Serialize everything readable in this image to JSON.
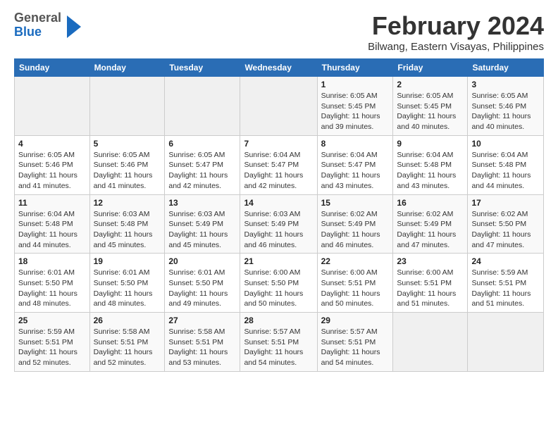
{
  "logo": {
    "line1": "General",
    "line2": "Blue"
  },
  "title": "February 2024",
  "subtitle": "Bilwang, Eastern Visayas, Philippines",
  "days_of_week": [
    "Sunday",
    "Monday",
    "Tuesday",
    "Wednesday",
    "Thursday",
    "Friday",
    "Saturday"
  ],
  "weeks": [
    [
      {
        "day": "",
        "info": ""
      },
      {
        "day": "",
        "info": ""
      },
      {
        "day": "",
        "info": ""
      },
      {
        "day": "",
        "info": ""
      },
      {
        "day": "1",
        "info": "Sunrise: 6:05 AM\nSunset: 5:45 PM\nDaylight: 11 hours and 39 minutes."
      },
      {
        "day": "2",
        "info": "Sunrise: 6:05 AM\nSunset: 5:45 PM\nDaylight: 11 hours and 40 minutes."
      },
      {
        "day": "3",
        "info": "Sunrise: 6:05 AM\nSunset: 5:46 PM\nDaylight: 11 hours and 40 minutes."
      }
    ],
    [
      {
        "day": "4",
        "info": "Sunrise: 6:05 AM\nSunset: 5:46 PM\nDaylight: 11 hours and 41 minutes."
      },
      {
        "day": "5",
        "info": "Sunrise: 6:05 AM\nSunset: 5:46 PM\nDaylight: 11 hours and 41 minutes."
      },
      {
        "day": "6",
        "info": "Sunrise: 6:05 AM\nSunset: 5:47 PM\nDaylight: 11 hours and 42 minutes."
      },
      {
        "day": "7",
        "info": "Sunrise: 6:04 AM\nSunset: 5:47 PM\nDaylight: 11 hours and 42 minutes."
      },
      {
        "day": "8",
        "info": "Sunrise: 6:04 AM\nSunset: 5:47 PM\nDaylight: 11 hours and 43 minutes."
      },
      {
        "day": "9",
        "info": "Sunrise: 6:04 AM\nSunset: 5:48 PM\nDaylight: 11 hours and 43 minutes."
      },
      {
        "day": "10",
        "info": "Sunrise: 6:04 AM\nSunset: 5:48 PM\nDaylight: 11 hours and 44 minutes."
      }
    ],
    [
      {
        "day": "11",
        "info": "Sunrise: 6:04 AM\nSunset: 5:48 PM\nDaylight: 11 hours and 44 minutes."
      },
      {
        "day": "12",
        "info": "Sunrise: 6:03 AM\nSunset: 5:48 PM\nDaylight: 11 hours and 45 minutes."
      },
      {
        "day": "13",
        "info": "Sunrise: 6:03 AM\nSunset: 5:49 PM\nDaylight: 11 hours and 45 minutes."
      },
      {
        "day": "14",
        "info": "Sunrise: 6:03 AM\nSunset: 5:49 PM\nDaylight: 11 hours and 46 minutes."
      },
      {
        "day": "15",
        "info": "Sunrise: 6:02 AM\nSunset: 5:49 PM\nDaylight: 11 hours and 46 minutes."
      },
      {
        "day": "16",
        "info": "Sunrise: 6:02 AM\nSunset: 5:49 PM\nDaylight: 11 hours and 47 minutes."
      },
      {
        "day": "17",
        "info": "Sunrise: 6:02 AM\nSunset: 5:50 PM\nDaylight: 11 hours and 47 minutes."
      }
    ],
    [
      {
        "day": "18",
        "info": "Sunrise: 6:01 AM\nSunset: 5:50 PM\nDaylight: 11 hours and 48 minutes."
      },
      {
        "day": "19",
        "info": "Sunrise: 6:01 AM\nSunset: 5:50 PM\nDaylight: 11 hours and 48 minutes."
      },
      {
        "day": "20",
        "info": "Sunrise: 6:01 AM\nSunset: 5:50 PM\nDaylight: 11 hours and 49 minutes."
      },
      {
        "day": "21",
        "info": "Sunrise: 6:00 AM\nSunset: 5:50 PM\nDaylight: 11 hours and 50 minutes."
      },
      {
        "day": "22",
        "info": "Sunrise: 6:00 AM\nSunset: 5:51 PM\nDaylight: 11 hours and 50 minutes."
      },
      {
        "day": "23",
        "info": "Sunrise: 6:00 AM\nSunset: 5:51 PM\nDaylight: 11 hours and 51 minutes."
      },
      {
        "day": "24",
        "info": "Sunrise: 5:59 AM\nSunset: 5:51 PM\nDaylight: 11 hours and 51 minutes."
      }
    ],
    [
      {
        "day": "25",
        "info": "Sunrise: 5:59 AM\nSunset: 5:51 PM\nDaylight: 11 hours and 52 minutes."
      },
      {
        "day": "26",
        "info": "Sunrise: 5:58 AM\nSunset: 5:51 PM\nDaylight: 11 hours and 52 minutes."
      },
      {
        "day": "27",
        "info": "Sunrise: 5:58 AM\nSunset: 5:51 PM\nDaylight: 11 hours and 53 minutes."
      },
      {
        "day": "28",
        "info": "Sunrise: 5:57 AM\nSunset: 5:51 PM\nDaylight: 11 hours and 54 minutes."
      },
      {
        "day": "29",
        "info": "Sunrise: 5:57 AM\nSunset: 5:51 PM\nDaylight: 11 hours and 54 minutes."
      },
      {
        "day": "",
        "info": ""
      },
      {
        "day": "",
        "info": ""
      }
    ]
  ]
}
